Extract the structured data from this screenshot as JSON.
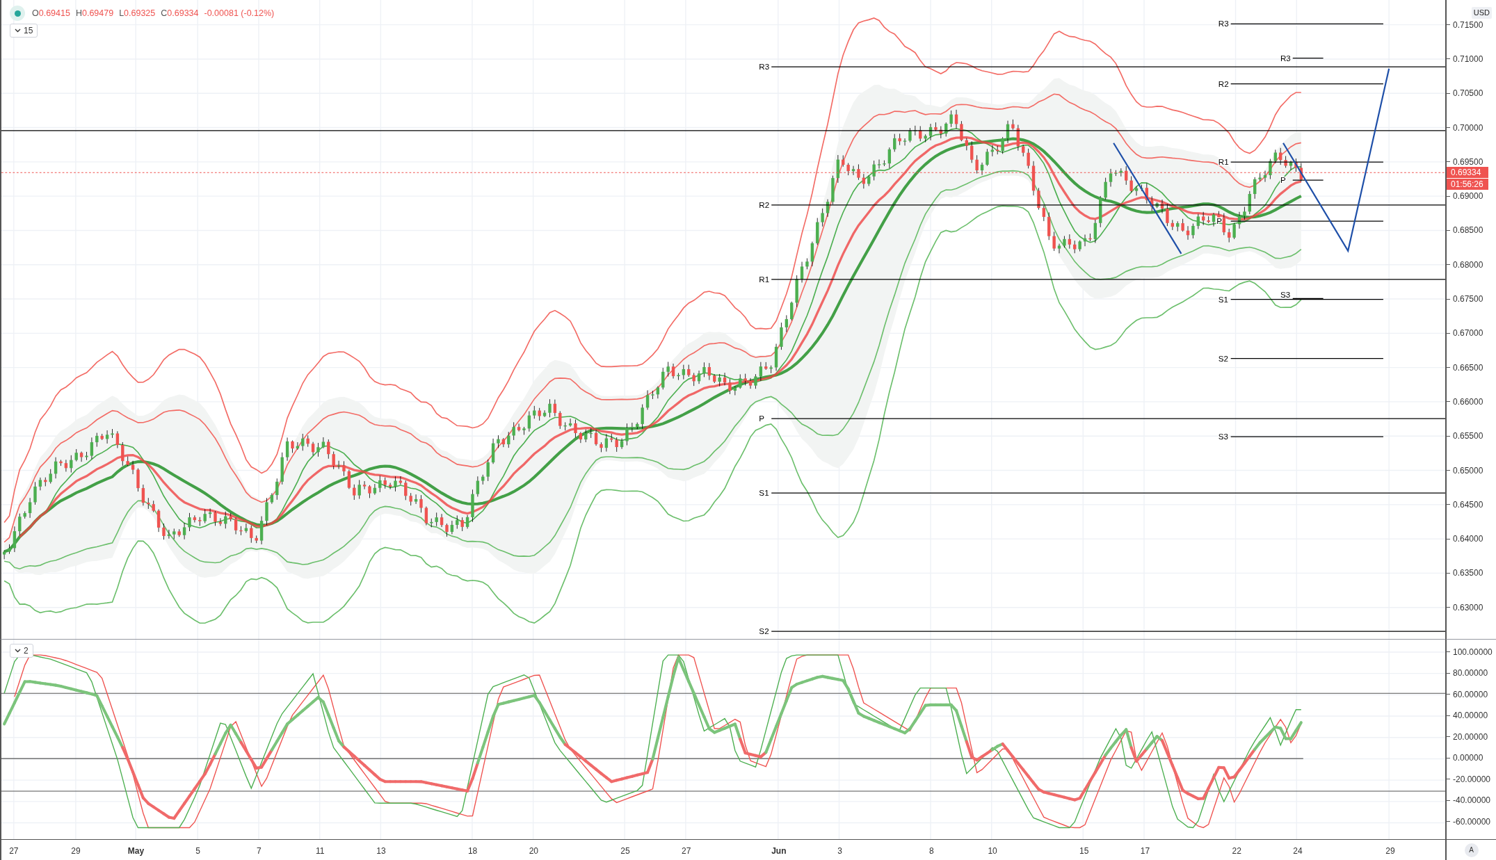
{
  "legend": {
    "ohlc": [
      {
        "label": "O",
        "value": "0.69415"
      },
      {
        "label": "H",
        "value": "0.69479"
      },
      {
        "label": "L",
        "value": "0.69325"
      },
      {
        "label": "C",
        "value": "0.69334"
      }
    ],
    "change": "-0.00081 (-0.12%)"
  },
  "price_pane": {
    "collapse_button": "15",
    "pivot_labels": [
      "R3",
      "R2",
      "R1",
      "P",
      "S1",
      "S2",
      "R3",
      "R2",
      "R1",
      "P",
      "S1",
      "S2",
      "S3",
      "R3",
      "P",
      "S3"
    ]
  },
  "price_axis": {
    "currency": "USD",
    "ticks": [
      "0.71500",
      "0.71000",
      "0.70500",
      "0.70000",
      "0.69500",
      "0.69000",
      "0.68500",
      "0.68000",
      "0.67500",
      "0.67000",
      "0.66500",
      "0.66000",
      "0.65500",
      "0.65000",
      "0.64500",
      "0.64000",
      "0.63500",
      "0.63000"
    ],
    "last_price": "0.69334",
    "countdown": "01:56:26"
  },
  "oscillator_pane": {
    "collapse_button": "2"
  },
  "oscillator_axis": {
    "ticks": [
      "100.00000",
      "80.00000",
      "60.00000",
      "40.00000",
      "20.00000",
      "0.00000",
      "-20.00000",
      "-40.00000",
      "-60.00000"
    ]
  },
  "time_axis": {
    "ticks": [
      {
        "label": "27",
        "kind": "day"
      },
      {
        "label": "29",
        "kind": "day"
      },
      {
        "label": "May",
        "kind": "month"
      },
      {
        "label": "5",
        "kind": "day"
      },
      {
        "label": "7",
        "kind": "day"
      },
      {
        "label": "11",
        "kind": "day"
      },
      {
        "label": "13",
        "kind": "day"
      },
      {
        "label": "18",
        "kind": "day"
      },
      {
        "label": "20",
        "kind": "day"
      },
      {
        "label": "25",
        "kind": "day"
      },
      {
        "label": "27",
        "kind": "day"
      },
      {
        "label": "Jun",
        "kind": "month"
      },
      {
        "label": "3",
        "kind": "day"
      },
      {
        "label": "8",
        "kind": "day"
      },
      {
        "label": "10",
        "kind": "day"
      },
      {
        "label": "15",
        "kind": "day"
      },
      {
        "label": "17",
        "kind": "day"
      },
      {
        "label": "22",
        "kind": "day"
      },
      {
        "label": "24",
        "kind": "day"
      },
      {
        "label": "29",
        "kind": "day"
      }
    ],
    "auto_button": "A"
  }
}
